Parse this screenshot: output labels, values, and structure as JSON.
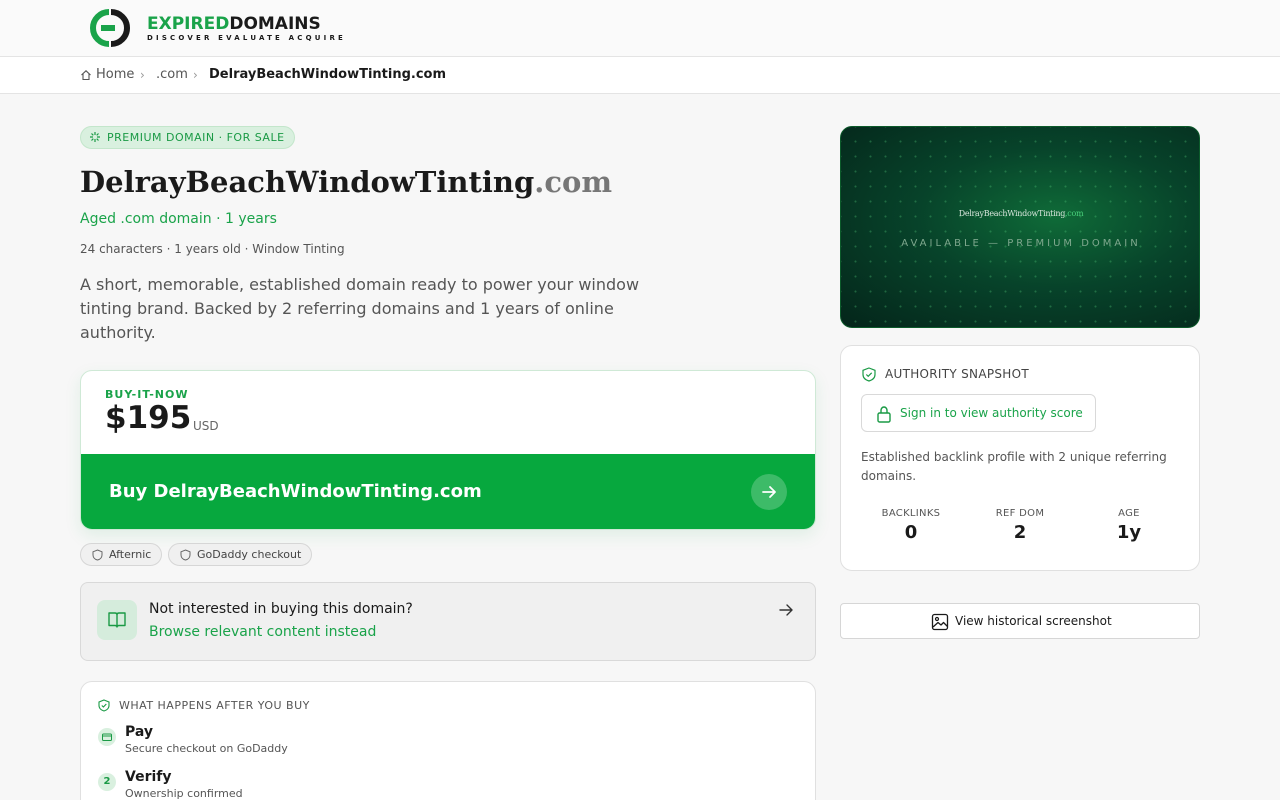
{
  "header": {
    "logo_primary": "EXPIRED",
    "logo_secondary": "DOMAINS",
    "logo_tagline": "DISCOVER EVALUATE ACQUIRE"
  },
  "breadcrumb": {
    "home": "Home",
    "tld": ".com",
    "current": "DelrayBeachWindowTinting.com"
  },
  "listing": {
    "badge": "PREMIUM DOMAIN · FOR SALE",
    "name": "DelrayBeachWindowTinting",
    "tld": ".com",
    "subtitle": "Aged .com domain · 1 years",
    "meta": "24 characters · 1 years old · Window Tinting",
    "description": "A short, memorable, established domain ready to power your window tinting brand. Backed by 2 referring domains and 1 years of online authority."
  },
  "purchase": {
    "label": "BUY-IT-NOW",
    "price": "$195",
    "currency": "USD",
    "button_label": "Buy DelrayBeachWindowTinting.com"
  },
  "marketplaces": [
    "Afternic",
    "GoDaddy checkout"
  ],
  "browse": {
    "question": "Not interested in buying this domain?",
    "link": "Browse relevant content instead"
  },
  "after_buy": {
    "heading": "WHAT HAPPENS AFTER YOU BUY",
    "steps": [
      {
        "marker": "",
        "title": "Pay",
        "subtitle": "Secure checkout on GoDaddy"
      },
      {
        "marker": "2",
        "title": "Verify",
        "subtitle": "Ownership confirmed"
      }
    ]
  },
  "preview": {
    "name": "DelrayBeachWindowTinting",
    "tld": ".com",
    "tagline": "AVAILABLE — PREMIUM DOMAIN"
  },
  "authority": {
    "heading": "AUTHORITY SNAPSHOT",
    "signin_label": "Sign in to view authority score",
    "description": "Established backlink profile with 2 unique referring domains.",
    "stats": [
      {
        "label": "BACKLINKS",
        "value": "0"
      },
      {
        "label": "REF DOM",
        "value": "2"
      },
      {
        "label": "AGE",
        "value": "1y"
      }
    ]
  },
  "history": {
    "label": "View historical screenshot"
  },
  "colors": {
    "brand_green": "#07a83e",
    "accent_green": "#1aa34a",
    "preview_bg": "#07432a"
  }
}
